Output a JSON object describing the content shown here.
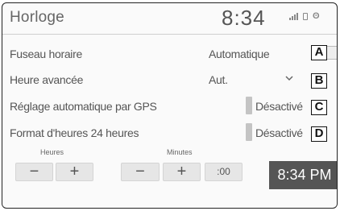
{
  "header": {
    "title": "Horloge",
    "time": "8:34",
    "status_icons": [
      "signal-icon",
      "phone-icon",
      "bluetooth-icon"
    ],
    "bluetooth_glyph": "ʘ"
  },
  "settings": [
    {
      "label": "Fuseau horaire",
      "value": "Automatique",
      "marker": "A",
      "control": "arrow"
    },
    {
      "label": "Heure avancée",
      "value": "Aut.",
      "marker": "B",
      "control": "dropdown",
      "chevron": "⌄"
    },
    {
      "label": "Réglage automatique par GPS",
      "value": "Désactivé",
      "marker": "C",
      "control": "toggle"
    },
    {
      "label": "Format d'heures 24 heures",
      "value": "Désactivé",
      "marker": "D",
      "control": "toggle"
    }
  ],
  "time_adjust": {
    "hours_label": "Heures",
    "minutes_label": "Minutes",
    "minus": "−",
    "plus": "+",
    "reset_label": ":00",
    "display_time": "8:34 PM"
  }
}
